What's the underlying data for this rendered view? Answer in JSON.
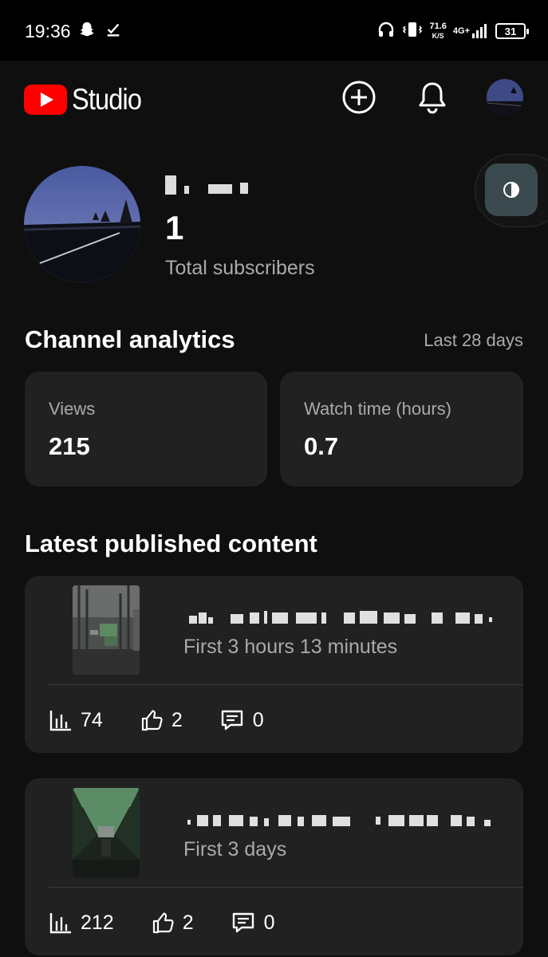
{
  "status_bar": {
    "time": "19:36",
    "net_speed_value": "71.6",
    "net_speed_unit": "K/S",
    "net_type": "4G+",
    "battery": "31",
    "icons": [
      "snapchat-icon",
      "download-done-icon",
      "headphones-icon",
      "vibrate-icon",
      "signal-icon"
    ]
  },
  "app_bar": {
    "brand": "Studio",
    "icons": [
      "youtube-logo-icon",
      "create-plus-icon",
      "notifications-bell-icon",
      "account-avatar"
    ]
  },
  "channel": {
    "name_redacted": true,
    "subscriber_count": "1",
    "subscriber_label": "Total subscribers"
  },
  "analytics": {
    "title": "Channel analytics",
    "range": "Last 28 days",
    "metrics": [
      {
        "label": "Views",
        "value": "215"
      },
      {
        "label": "Watch time (hours)",
        "value": "0.7"
      }
    ]
  },
  "latest": {
    "title": "Latest published content",
    "items": [
      {
        "period": "First 3 hours 13 minutes",
        "views": "74",
        "likes": "2",
        "comments": "0"
      },
      {
        "period": "First 3 days",
        "views": "212",
        "likes": "2",
        "comments": "0"
      }
    ]
  },
  "colors": {
    "background": "#0f0f0f",
    "card": "#212121",
    "brand_red": "#ff0000",
    "secondary_text": "#aaaaaa"
  }
}
